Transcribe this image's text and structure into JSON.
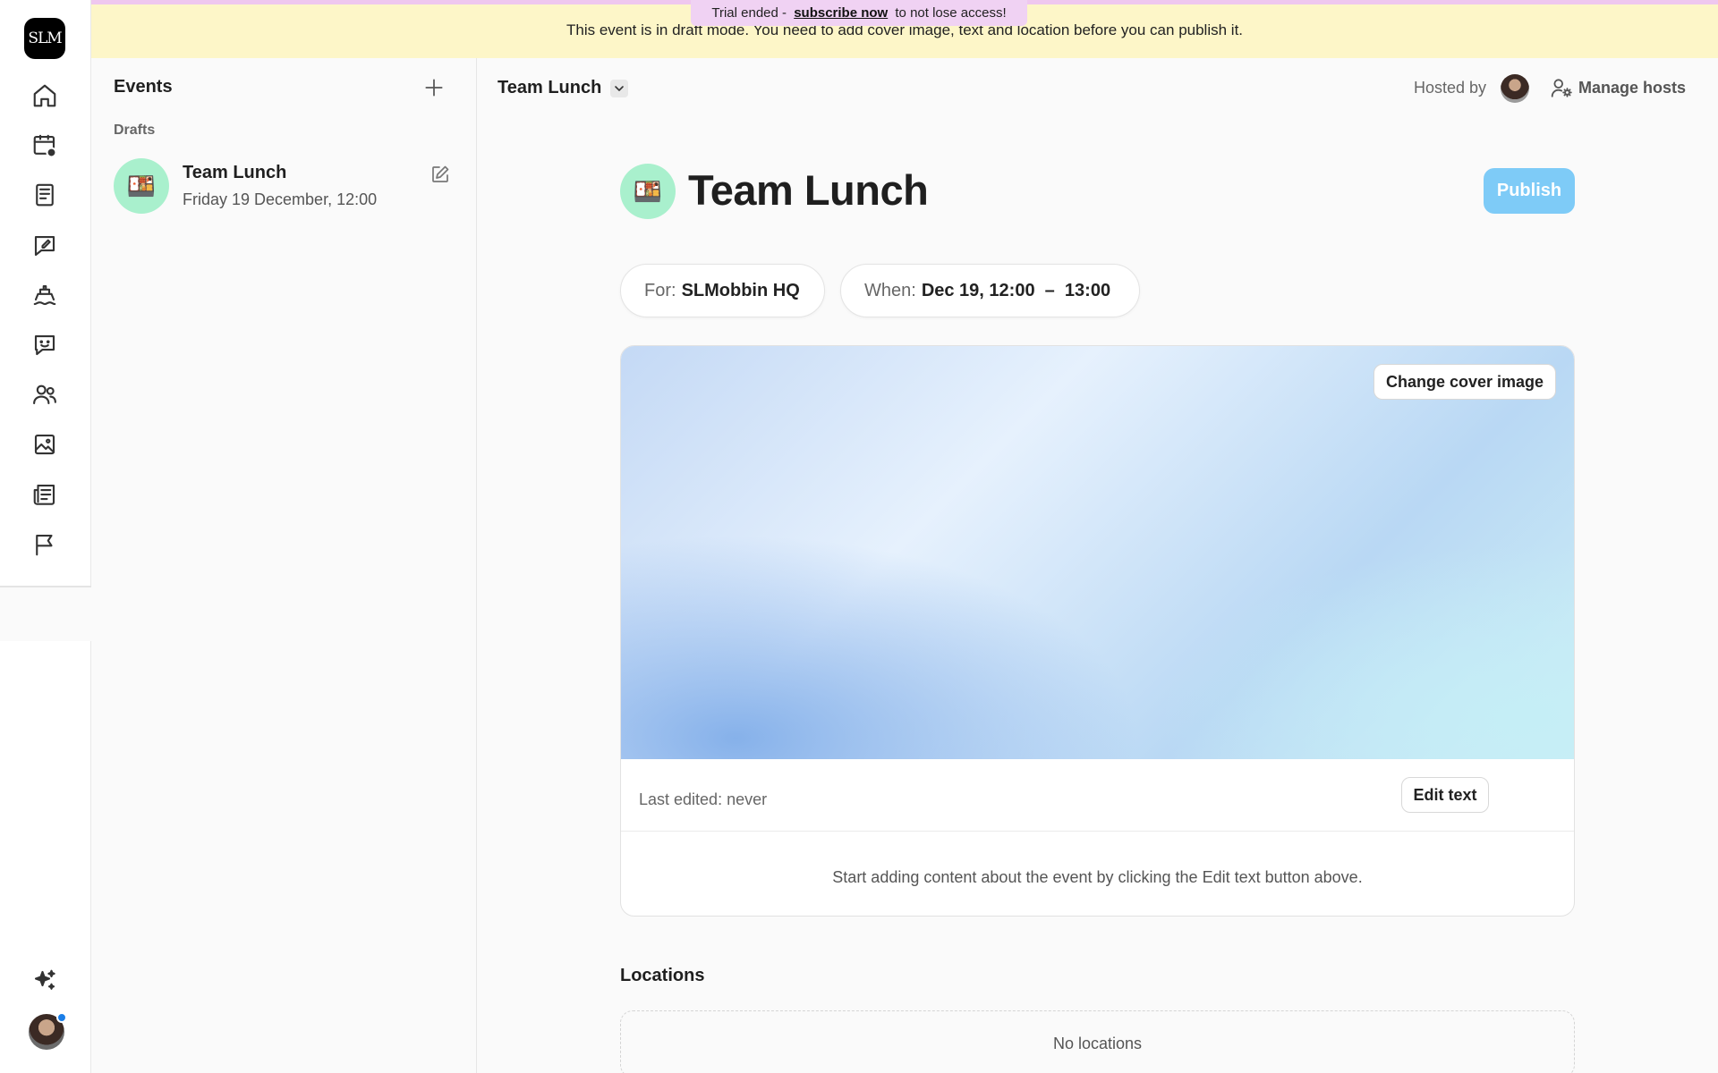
{
  "app": {
    "logo_text": "SLM"
  },
  "rail": {
    "icons": [
      "home-icon",
      "calendar-clock-icon",
      "book-icon",
      "edit-message-icon",
      "ship-icon",
      "smile-chat-icon",
      "users-icon",
      "image-icon",
      "news-icon",
      "flag-icon",
      "sparkles-icon"
    ]
  },
  "banner": {
    "message": "This event is in draft mode. You need to add cover image, text and location before you can publish it.",
    "trial_prefix": "Trial ended - ",
    "trial_link": "subscribe now",
    "trial_suffix": " to not lose access!"
  },
  "events_panel": {
    "title": "Events",
    "section": "Drafts",
    "items": [
      {
        "emoji": "🍱",
        "title": "Team Lunch",
        "subtitle": "Friday 19 December, 12:00"
      }
    ]
  },
  "header": {
    "event_name": "Team Lunch",
    "hosted_by": "Hosted by",
    "manage_hosts": "Manage hosts"
  },
  "event": {
    "emoji": "🍱",
    "title": "Team Lunch",
    "publish_label": "Publish",
    "for_key": "For:",
    "for_value": "SLMobbin HQ",
    "when_key": "When:",
    "when_value": "Dec 19, 12:00  –  13:00",
    "change_cover_label": "Change cover image",
    "last_edited": "Last edited: never",
    "edit_text_label": "Edit text",
    "content_help": "Start adding content about the event by clicking the Edit text button above."
  },
  "locations": {
    "title": "Locations",
    "empty": "No locations"
  },
  "colors": {
    "banner_bg": "#fdf6c8",
    "trial_bg": "#f0d2f3",
    "publish_bg": "#7ecbf7",
    "emoji_bg": "#a9f0cd",
    "notification_dot": "#1a7ee8"
  }
}
